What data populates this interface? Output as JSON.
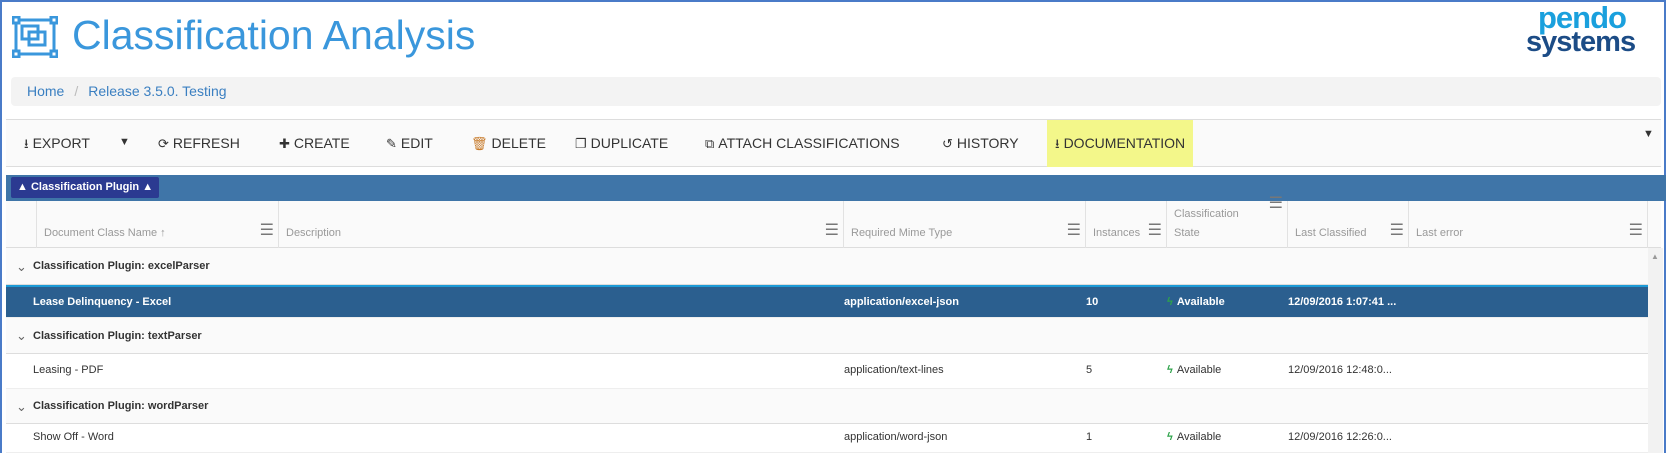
{
  "header": {
    "title": "Classification Analysis",
    "logo_line1": "pendo",
    "logo_line2": "systems"
  },
  "breadcrumb": [
    "Home",
    "Release 3.5.0. Testing"
  ],
  "toolbar": {
    "export": "EXPORT",
    "refresh": "REFRESH",
    "create": "CREATE",
    "edit": "EDIT",
    "delete": "DELETE",
    "duplicate": "DUPLICATE",
    "attach": "ATTACH CLASSIFICATIONS",
    "history": "HISTORY",
    "documentation": "DOCUMENTATION"
  },
  "grouping": {
    "chip": "Classification Plugin"
  },
  "columns": {
    "name": "Document Class Name ↑",
    "description": "Description",
    "mime": "Required Mime Type",
    "instances": "Instances",
    "state1": "Classification",
    "state2": "State",
    "last_classified": "Last Classified",
    "last_error": "Last error"
  },
  "groups": [
    {
      "label": "Classification Plugin: excelParser",
      "rows": [
        {
          "name": "Lease Delinquency - Excel",
          "description": "",
          "mime": "application/excel-json",
          "instances": "10",
          "state": "Available",
          "last_classified": "12/09/2016 1:07:41 ...",
          "last_error": ""
        }
      ]
    },
    {
      "label": "Classification Plugin: textParser",
      "rows": [
        {
          "name": "Leasing - PDF",
          "description": "",
          "mime": "application/text-lines",
          "instances": "5",
          "state": "Available",
          "last_classified": "12/09/2016 12:48:0...",
          "last_error": ""
        }
      ]
    },
    {
      "label": "Classification Plugin: wordParser",
      "rows": [
        {
          "name": "Show Off - Word",
          "description": "",
          "mime": "application/word-json",
          "instances": "1",
          "state": "Available",
          "last_classified": "12/09/2016 12:26:0...",
          "last_error": ""
        }
      ]
    }
  ]
}
